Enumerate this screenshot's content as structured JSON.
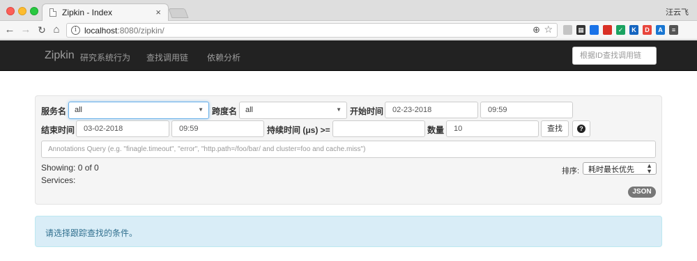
{
  "browser": {
    "tab_title": "Zipkin - Index",
    "tab_close": "×",
    "profile_name": "汪云飞",
    "url_host": "localhost",
    "url_rest": ":8080/zipkin/",
    "nav": {
      "back": "←",
      "forward": "→",
      "reload": "↻",
      "home": "⌂",
      "zoom": "⊕",
      "star": "☆",
      "info": "i"
    },
    "extensions": [
      {
        "label": "",
        "color": "#c4c4c4"
      },
      {
        "label": "▦",
        "color": "#333333"
      },
      {
        "label": "",
        "color": "#1a73e8"
      },
      {
        "label": "",
        "color": "#d93025"
      },
      {
        "label": "✓",
        "color": "#1aa260"
      },
      {
        "label": "K",
        "color": "#1565c0"
      },
      {
        "label": "D",
        "color": "#e8453c"
      },
      {
        "label": "A",
        "color": "#1976d2"
      },
      {
        "label": "≡",
        "color": "#555555"
      }
    ]
  },
  "navbar": {
    "brand": "Zipkin",
    "brand_subtitle": "研究系统行为",
    "link_find": "查找调用链",
    "link_deps": "依赖分析",
    "trace_id_placeholder": "根据ID查找调用链"
  },
  "search": {
    "service_label": "服务名",
    "service_value": "all",
    "span_label": "跨度名",
    "span_value": "all",
    "start_label": "开始时间",
    "start_date": "02-23-2018",
    "start_time": "09:59",
    "end_label": "结束时间",
    "end_date": "03-02-2018",
    "end_time": "09:59",
    "duration_label": "持续时间 (μs) >=",
    "duration_value": "",
    "limit_label": "数量",
    "limit_value": "10",
    "find_button": "查找",
    "help_button": "?",
    "annotations_placeholder": "Annotations Query (e.g. \"finagle.timeout\", \"error\", \"http.path=/foo/bar/ and cluster=foo and cache.miss\")",
    "showing_text": "Showing: 0 of 0",
    "services_text": "Services:",
    "sort_label": "排序:",
    "sort_value": "耗时最长优先",
    "json_badge": "JSON"
  },
  "alert_text": "请选择跟踪查找的条件。",
  "colors": {
    "navbar_bg": "#222222",
    "alert_bg": "#d9edf7",
    "alert_text": "#31708f",
    "panel_bg": "#f5f5f5",
    "json_badge_bg": "#777777"
  }
}
